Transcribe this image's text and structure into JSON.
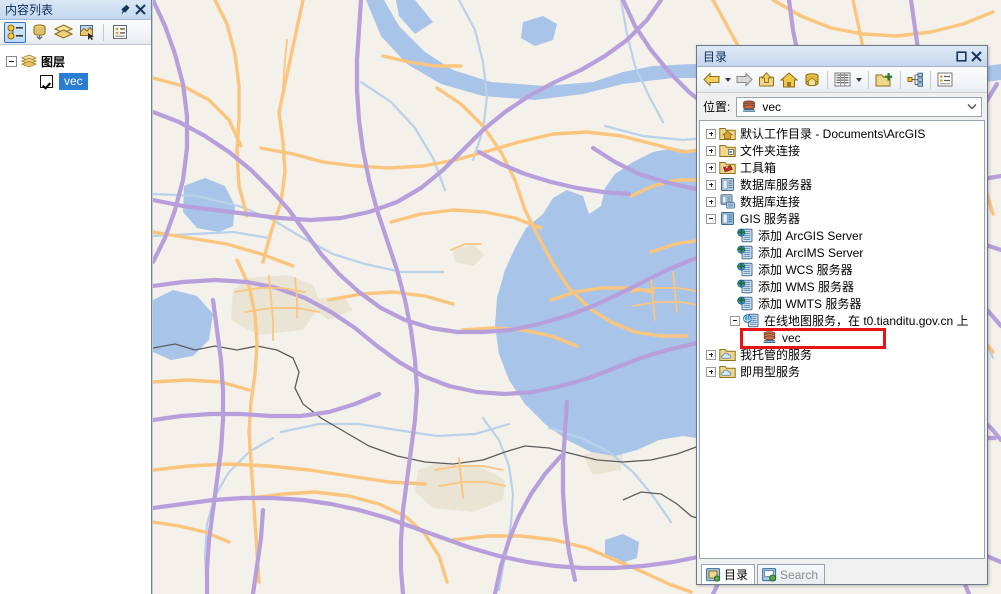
{
  "toc": {
    "title": "内容列表",
    "pin_icon": "pin-icon",
    "close_icon": "close-icon",
    "tools": [
      {
        "name": "list-by-drawing-order-icon",
        "active": true
      },
      {
        "name": "list-by-source-icon",
        "active": false
      },
      {
        "name": "list-by-visibility-icon",
        "active": false
      },
      {
        "name": "list-by-selection-icon",
        "active": false
      },
      {
        "name": "options-icon",
        "active": false
      }
    ],
    "root_label": "图层",
    "layers": [
      {
        "label": "vec",
        "checked": true,
        "selected": true
      }
    ]
  },
  "catalog": {
    "title": "目录",
    "maximize_icon": "maximize-icon",
    "close_icon": "close-icon",
    "toolbar": [
      {
        "name": "back-icon",
        "label": "后退"
      },
      {
        "name": "back-dropdown-icon",
        "label": ""
      },
      {
        "name": "forward-icon",
        "label": "前进"
      },
      {
        "name": "up-one-level-icon",
        "label": "上一级"
      },
      {
        "name": "home-icon",
        "label": "主目录"
      },
      {
        "name": "default-geodatabase-icon",
        "label": "默认地理数据库"
      },
      {
        "name": "contents-view-icon",
        "label": "内容视图"
      },
      {
        "name": "contents-view-dropdown-icon",
        "label": ""
      },
      {
        "name": "connect-to-folder-icon",
        "label": "连接到文件夹"
      },
      {
        "name": "toggle-tree-icon",
        "label": "目录树"
      },
      {
        "name": "item-description-icon",
        "label": "项目描述"
      }
    ],
    "location": {
      "label": "位置:",
      "value": "vec",
      "icon": "map-service-icon",
      "dropdown_icon": "chevron-down-icon"
    },
    "tree": [
      {
        "depth": 0,
        "expander": "plus",
        "icon": "home-folder-icon",
        "label": "默认工作目录 - Documents\\ArcGIS"
      },
      {
        "depth": 0,
        "expander": "plus",
        "icon": "folder-connection-icon",
        "label": "文件夹连接"
      },
      {
        "depth": 0,
        "expander": "plus",
        "icon": "toolbox-folder-icon",
        "label": "工具箱"
      },
      {
        "depth": 0,
        "expander": "plus",
        "icon": "database-server-icon",
        "label": "数据库服务器"
      },
      {
        "depth": 0,
        "expander": "plus",
        "icon": "database-connect-icon",
        "label": "数据库连接"
      },
      {
        "depth": 0,
        "expander": "minus",
        "icon": "gis-server-icon",
        "label": "GIS 服务器"
      },
      {
        "depth": 1,
        "expander": "none",
        "icon": "add-server-icon",
        "label": "添加 ArcGIS Server"
      },
      {
        "depth": 1,
        "expander": "none",
        "icon": "add-server-icon",
        "label": "添加 ArcIMS Server"
      },
      {
        "depth": 1,
        "expander": "none",
        "icon": "add-server-icon",
        "label": "添加 WCS 服务器"
      },
      {
        "depth": 1,
        "expander": "none",
        "icon": "add-server-icon",
        "label": "添加 WMS 服务器"
      },
      {
        "depth": 1,
        "expander": "none",
        "icon": "add-server-icon",
        "label": "添加 WMTS 服务器"
      },
      {
        "depth": 2,
        "expander": "minus",
        "icon": "server-connection-icon",
        "label": "在线地图服务，在 t0.tianditu.gov.cn 上"
      },
      {
        "depth": 3,
        "expander": "none",
        "icon": "map-service-icon",
        "label": "vec",
        "highlighted": true
      },
      {
        "depth": 0,
        "expander": "plus",
        "icon": "cloud-folder-icon",
        "label": "我托管的服务"
      },
      {
        "depth": 0,
        "expander": "plus",
        "icon": "cloud-folder-icon",
        "label": "即用型服务"
      }
    ],
    "highlight_color": "#e81313",
    "tabs": [
      {
        "label": "目录",
        "icon": "catalog-icon",
        "active": true
      },
      {
        "label": "Search",
        "icon": "search-icon",
        "active": false
      }
    ]
  },
  "map": {
    "name": "tianditu-vec-basemap",
    "description": "天地图矢量底图 - 太湖区域",
    "colors": {
      "land": "#f3f1ea",
      "water": "#a8c4e8",
      "expressway": "#b79fdc",
      "highway": "#fbc57e",
      "river": "#b9d1ea",
      "boundary": "#5b5b5b",
      "urban": "#e9e5d6"
    }
  }
}
